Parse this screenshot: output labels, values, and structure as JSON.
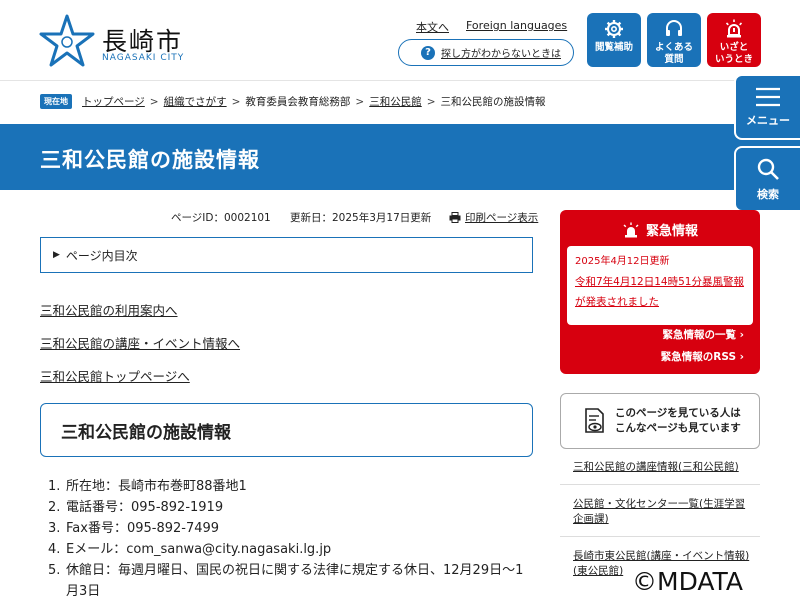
{
  "header": {
    "logo_jp": "長崎市",
    "logo_en": "NAGASAKI CITY",
    "links": {
      "main_text": "本文へ",
      "foreign": "Foreign languages"
    },
    "help_label": "探し方がわからないときは",
    "buttons": {
      "accessibility": "閲覧補助",
      "faq_line1": "よくある",
      "faq_line2": "質問",
      "emergency_line1": "いざと",
      "emergency_line2": "いうとき"
    }
  },
  "breadcrumb": {
    "here": "現在地",
    "items": [
      "トップページ",
      "組織でさがす",
      "教育委員会教育総務部",
      "三和公民館",
      "三和公民館の施設情報"
    ],
    "sep": ">"
  },
  "page_title": "三和公民館の施設情報",
  "side_tabs": {
    "menu": "メニュー",
    "search": "検索"
  },
  "meta": {
    "page_id": "ページID：0002101",
    "updated": "更新日：2025年3月17日更新",
    "print": "印刷ページ表示"
  },
  "toc": "ページ内目次",
  "page_links": [
    "三和公民館の利用案内へ",
    "三和公民館の講座・イベント情報へ",
    "三和公民館トップページへ"
  ],
  "section_heading": "三和公民館の施設情報",
  "info_list": [
    {
      "n": "1.",
      "text": "所在地：長崎市布巻町88番地1"
    },
    {
      "n": "2.",
      "text": "電話番号：095-892-1919"
    },
    {
      "n": "3.",
      "text": "Fax番号：095-892-7499"
    },
    {
      "n": "4.",
      "text": "Eメール：com_sanwa@city.nagasaki.lg.jp"
    },
    {
      "n": "5.",
      "text": "休館日：毎週月曜日、国民の祝日に関する法律に規定する休日、12月29日〜1月3日"
    }
  ],
  "emergency": {
    "title": "緊急情報",
    "date": "2025年4月12日更新",
    "alert": "令和7年4月12日14時51分暴風警報が発表されました",
    "list_link": "緊急情報の一覧",
    "rss_link": "緊急情報のRSS"
  },
  "others": {
    "line1": "このページを見ている人は",
    "line2": "こんなページも見ています",
    "links": [
      "三和公民館の講座情報(三和公民館)",
      "公民館・文化センター一覧(生涯学習企画課)",
      "長崎市東公民館(講座・イベント情報)(東公民館)"
    ]
  },
  "watermark": "©MDATA",
  "colors": {
    "primary": "#1a72b8",
    "emergency": "#d7000f"
  }
}
